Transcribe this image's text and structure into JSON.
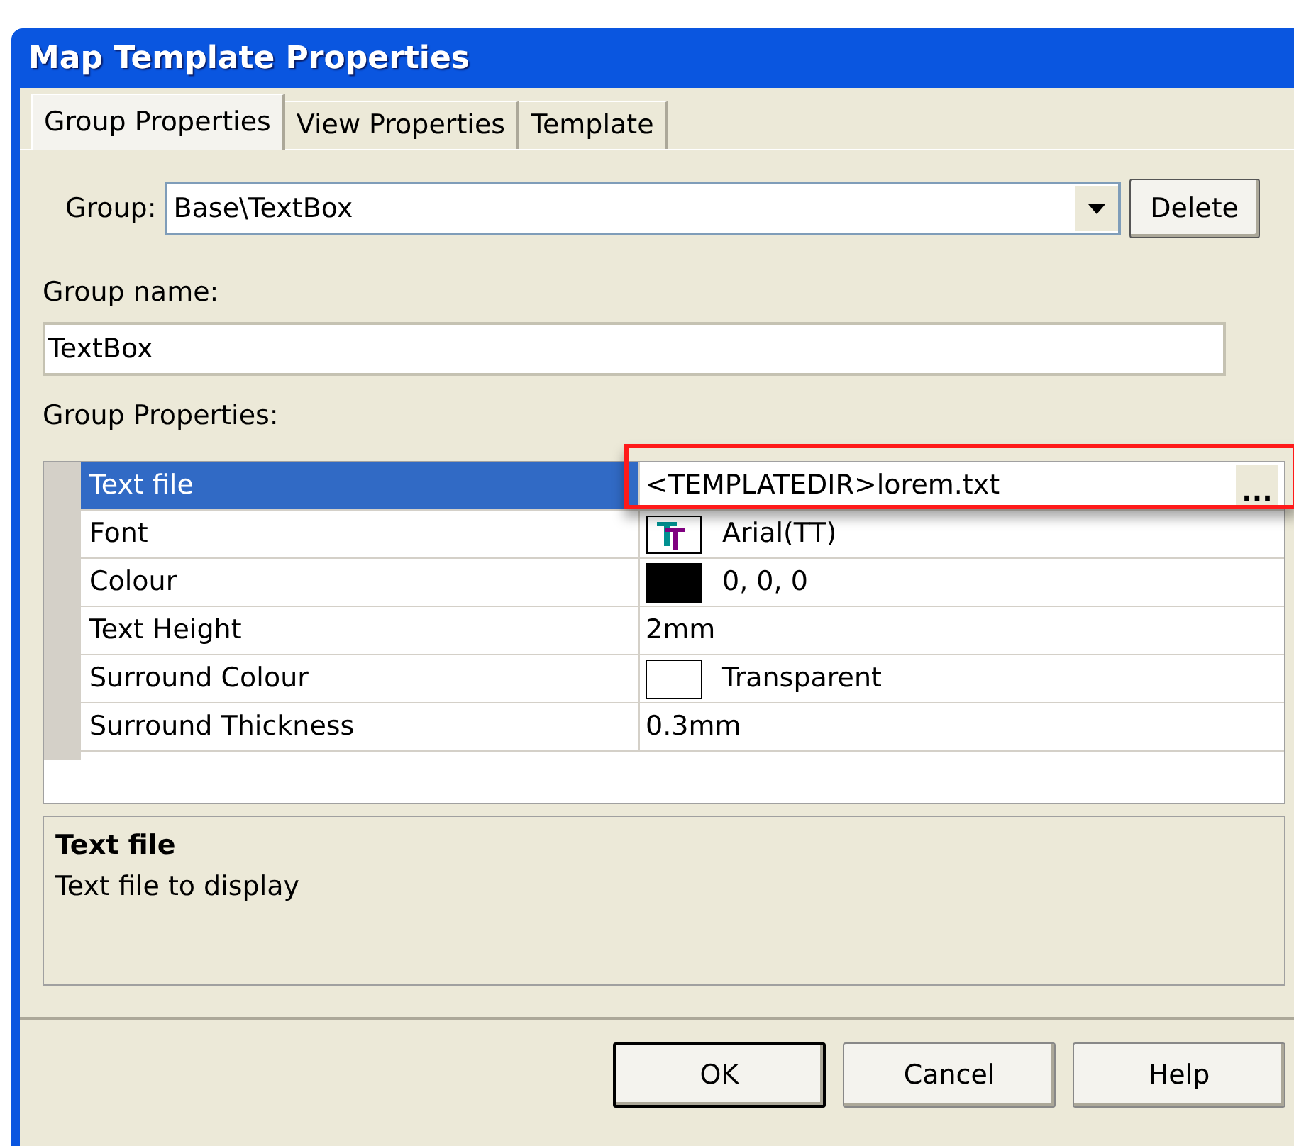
{
  "window": {
    "title": "Map Template Properties"
  },
  "tabs": [
    {
      "label": "Group Properties",
      "selected": true
    },
    {
      "label": "View Properties",
      "selected": false
    },
    {
      "label": "Template",
      "selected": false
    }
  ],
  "group": {
    "label": "Group:",
    "value": "Base\\TextBox",
    "delete_button": "Delete"
  },
  "group_name": {
    "label": "Group name:",
    "value": "TextBox"
  },
  "properties_label": "Group Properties:",
  "properties": [
    {
      "name": "Text file",
      "value": "<TEMPLATEDIR>lorem.txt",
      "kind": "file",
      "selected": true,
      "highlighted": true,
      "browse": "..."
    },
    {
      "name": "Font",
      "value": "Arial(TT)",
      "kind": "font",
      "selected": false
    },
    {
      "name": "Colour",
      "value": "0, 0, 0",
      "kind": "colour",
      "color": "#000000",
      "selected": false
    },
    {
      "name": "Text Height",
      "value": "2mm",
      "kind": "text",
      "selected": false
    },
    {
      "name": "Surround Colour",
      "value": "Transparent",
      "kind": "colour",
      "color": "#ffffff",
      "selected": false
    },
    {
      "name": "Surround Thickness",
      "value": "0.3mm",
      "kind": "text",
      "selected": false
    }
  ],
  "description": {
    "title": "Text file",
    "text": "Text file to display"
  },
  "buttons": [
    {
      "label": "OK",
      "default": true
    },
    {
      "label": "Cancel",
      "default": false
    },
    {
      "label": "Help",
      "default": false
    }
  ]
}
